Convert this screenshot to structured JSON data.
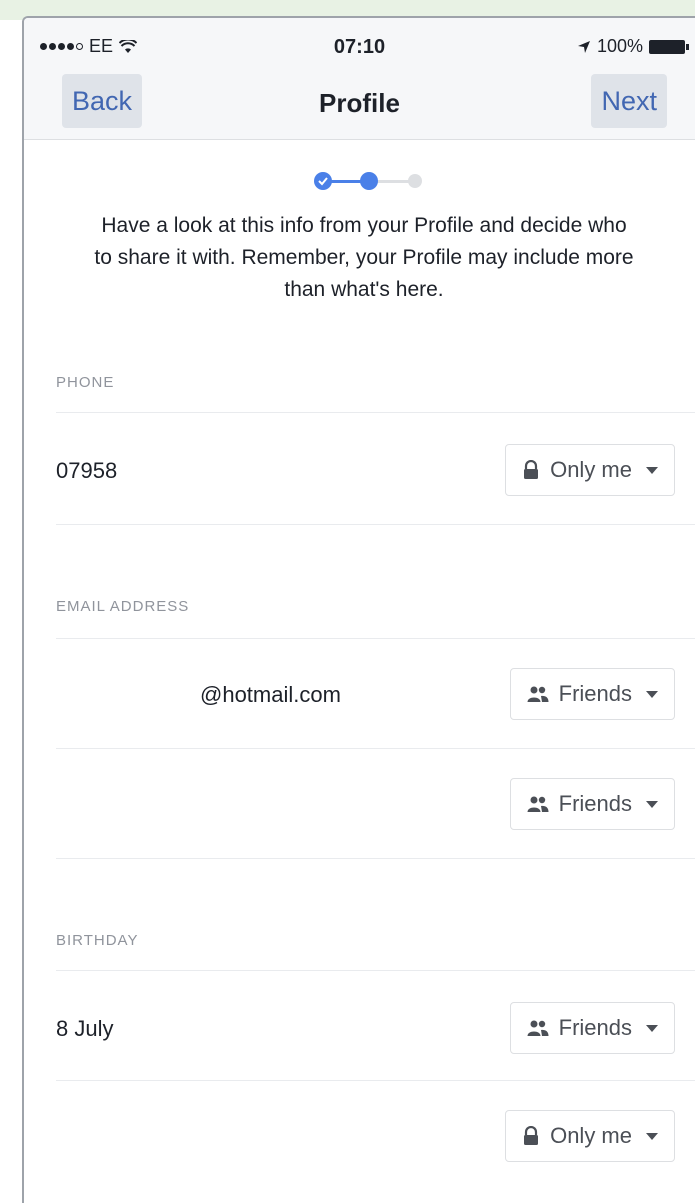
{
  "statusbar": {
    "carrier": "EE",
    "time": "07:10",
    "battery": "100%"
  },
  "nav": {
    "back_label": "Back",
    "title": "Profile",
    "next_label": "Next"
  },
  "intro_text": "Have a look at this info from your Profile and decide who to share it with. Remember, your Profile may include more than what's here.",
  "sections": {
    "phone": {
      "label": "PHONE",
      "value": "07958",
      "privacy": "Only me"
    },
    "email": {
      "label": "EMAIL ADDRESS",
      "value1": "@hotmail.com",
      "privacy1": "Friends",
      "privacy2": "Friends"
    },
    "birthday": {
      "label": "BIRTHDAY",
      "value": "8 July",
      "privacy1": "Friends",
      "privacy2": "Only me"
    }
  },
  "colors": {
    "accent": "#4a80e8",
    "link": "#4267b2",
    "muted": "#90949c"
  }
}
